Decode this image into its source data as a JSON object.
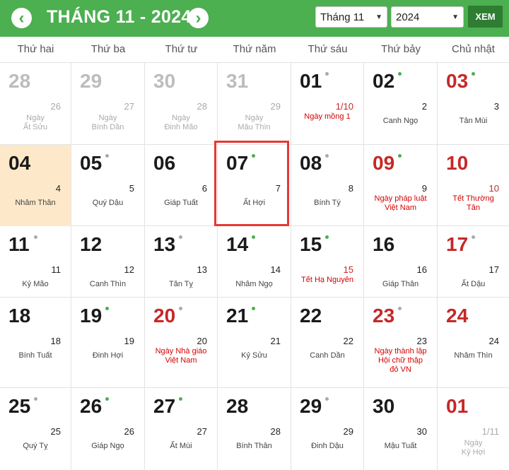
{
  "header": {
    "title": "THÁNG 11 - 2024",
    "prev_icon": "chevron-left-icon",
    "next_icon": "chevron-right-icon",
    "month_value": "Tháng 11",
    "year_value": "2024",
    "view_button": "XEM",
    "accent": "#4caf50"
  },
  "weekdays": [
    "Thứ hai",
    "Thứ ba",
    "Thứ tư",
    "Thứ năm",
    "Thứ sáu",
    "Thứ bảy",
    "Chủ nhật"
  ],
  "weeks": [
    [
      {
        "day": "28",
        "lunar": "26",
        "canchi": "Ngày\nẤt Sửu",
        "muted": true
      },
      {
        "day": "29",
        "lunar": "27",
        "canchi": "Ngày\nBính Dần",
        "muted": true
      },
      {
        "day": "30",
        "lunar": "28",
        "canchi": "Ngày\nĐinh Mão",
        "muted": true
      },
      {
        "day": "31",
        "lunar": "29",
        "canchi": "Ngày\nMậu Thìn",
        "muted": true
      },
      {
        "day": "01",
        "lunar": "1/10",
        "event": "Ngày mồng 1",
        "dot": "gray",
        "lunar_red": true
      },
      {
        "day": "02",
        "lunar": "2",
        "canchi": "Canh Ngọ",
        "dot": "green"
      },
      {
        "day": "03",
        "lunar": "3",
        "canchi": "Tân Mùi",
        "dot": "green",
        "red": true,
        "lunar_black": true
      }
    ],
    [
      {
        "day": "04",
        "lunar": "4",
        "canchi": "Nhâm Thân",
        "today": true
      },
      {
        "day": "05",
        "lunar": "5",
        "canchi": "Quý Dậu",
        "dot": "gray"
      },
      {
        "day": "06",
        "lunar": "6",
        "canchi": "Giáp Tuất"
      },
      {
        "day": "07",
        "lunar": "7",
        "canchi": "Ất Hợi",
        "dot": "green",
        "selected": true
      },
      {
        "day": "08",
        "lunar": "8",
        "canchi": "Bính Tý",
        "dot": "gray"
      },
      {
        "day": "09",
        "lunar": "9",
        "event": "Ngày pháp luật\nViệt Nam",
        "dot": "green",
        "red": true,
        "lunar_black": true
      },
      {
        "day": "10",
        "lunar": "10",
        "event": "Tết Thường\nTân",
        "red": true
      }
    ],
    [
      {
        "day": "11",
        "lunar": "11",
        "canchi": "Kỷ Mão",
        "dot": "gray"
      },
      {
        "day": "12",
        "lunar": "12",
        "canchi": "Canh Thìn"
      },
      {
        "day": "13",
        "lunar": "13",
        "canchi": "Tân Tỵ",
        "dot": "gray"
      },
      {
        "day": "14",
        "lunar": "14",
        "canchi": "Nhâm Ngọ",
        "dot": "green"
      },
      {
        "day": "15",
        "lunar": "15",
        "event": "Tết Hạ Nguyên",
        "dot": "green",
        "lunar_red": true
      },
      {
        "day": "16",
        "lunar": "16",
        "canchi": "Giáp Thân"
      },
      {
        "day": "17",
        "lunar": "17",
        "canchi": "Ất Dậu",
        "dot": "gray",
        "red": true,
        "lunar_black": true
      }
    ],
    [
      {
        "day": "18",
        "lunar": "18",
        "canchi": "Bính Tuất"
      },
      {
        "day": "19",
        "lunar": "19",
        "canchi": "Đinh Hợi",
        "dot": "green"
      },
      {
        "day": "20",
        "lunar": "20",
        "event": "Ngày Nhà giáo\nViệt Nam",
        "dot": "gray",
        "red": true,
        "lunar_black": true
      },
      {
        "day": "21",
        "lunar": "21",
        "canchi": "Kỷ Sửu",
        "dot": "green"
      },
      {
        "day": "22",
        "lunar": "22",
        "canchi": "Canh Dần"
      },
      {
        "day": "23",
        "lunar": "23",
        "event": "Ngày thành lập\nHội chữ thập\nđỏ VN",
        "dot": "gray",
        "red": true,
        "lunar_black": true
      },
      {
        "day": "24",
        "lunar": "24",
        "canchi": "Nhâm Thìn",
        "red": true,
        "lunar_black": true
      }
    ],
    [
      {
        "day": "25",
        "lunar": "25",
        "canchi": "Quý Tỵ",
        "dot": "gray"
      },
      {
        "day": "26",
        "lunar": "26",
        "canchi": "Giáp Ngọ",
        "dot": "green"
      },
      {
        "day": "27",
        "lunar": "27",
        "canchi": "Ất Mùi",
        "dot": "green"
      },
      {
        "day": "28",
        "lunar": "28",
        "canchi": "Bính Thân"
      },
      {
        "day": "29",
        "lunar": "29",
        "canchi": "Đinh Dậu",
        "dot": "gray"
      },
      {
        "day": "30",
        "lunar": "30",
        "canchi": "Mậu Tuất"
      },
      {
        "day": "01",
        "lunar": "1/11",
        "canchi": "Ngày\nKỷ Hợi",
        "red": true,
        "muted_sm": true
      }
    ]
  ]
}
